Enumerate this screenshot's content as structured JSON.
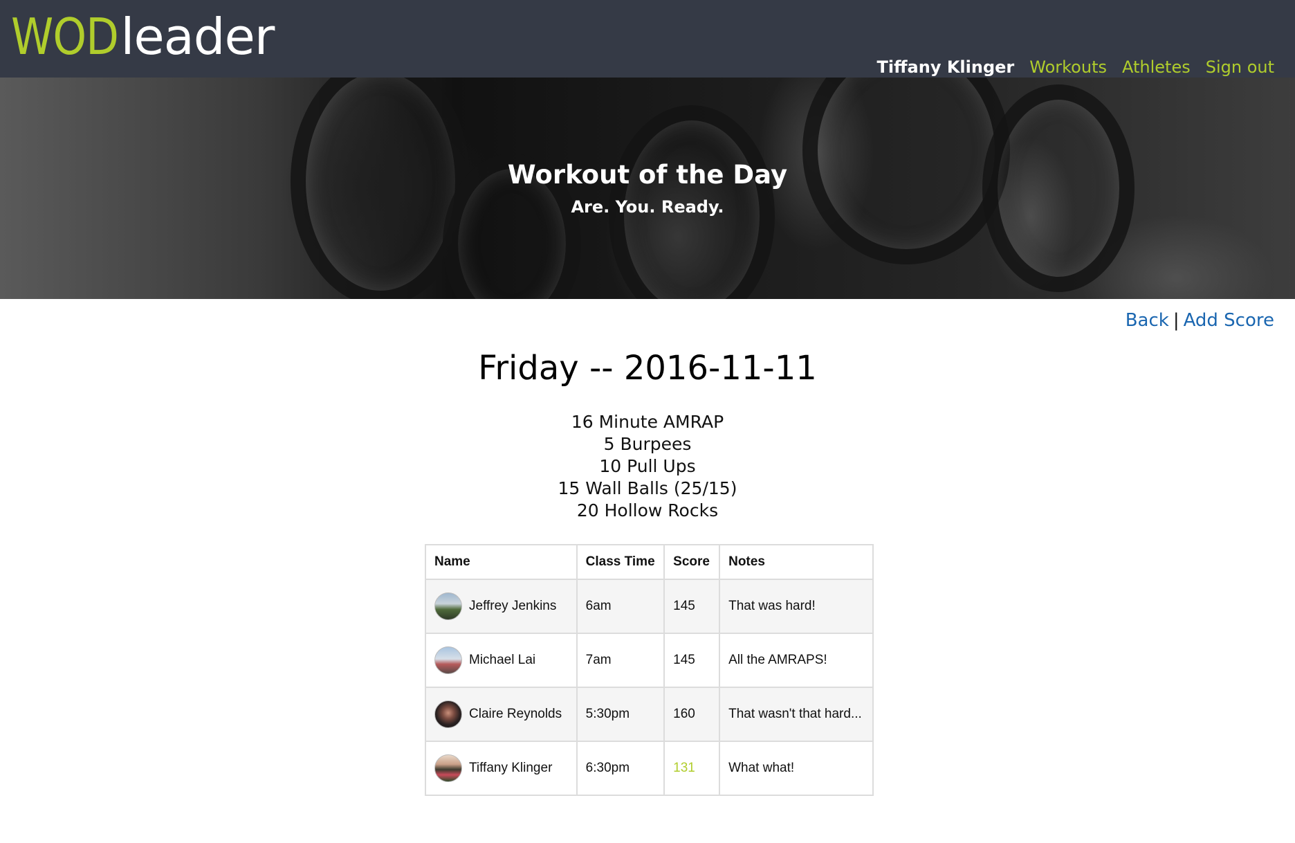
{
  "app": {
    "logo_part1": "WOD",
    "logo_part2": "leader",
    "brand_color": "#b0cd2c",
    "navbar_color": "#353a46"
  },
  "nav": {
    "user_name": "Tiffany Klinger",
    "links": [
      "Workouts",
      "Athletes",
      "Sign out"
    ]
  },
  "hero": {
    "title": "Workout of the Day",
    "subtitle": "Are. You. Ready."
  },
  "actions": {
    "back_label": "Back",
    "separator": "|",
    "add_score_label": "Add Score",
    "link_color": "#1a66b0"
  },
  "workout": {
    "heading": "Friday -- 2016-11-11",
    "lines": [
      "16 Minute AMRAP",
      "5 Burpees",
      "10 Pull Ups",
      "15 Wall Balls (25/15)",
      "20 Hollow Rocks"
    ]
  },
  "scores_table": {
    "headers": [
      "Name",
      "Class Time",
      "Score",
      "Notes"
    ],
    "rows": [
      {
        "name": "Jeffrey Jenkins",
        "class_time": "6am",
        "score": "145",
        "notes": "That was hard!",
        "avatar_icon": "athlete-avatar-icon"
      },
      {
        "name": "Michael Lai",
        "class_time": "7am",
        "score": "145",
        "notes": "All the AMRAPS!",
        "avatar_icon": "athlete-avatar-icon"
      },
      {
        "name": "Claire Reynolds",
        "class_time": "5:30pm",
        "score": "160",
        "notes": "That wasn't that hard...",
        "avatar_icon": "athlete-avatar-icon"
      },
      {
        "name": "Tiffany Klinger",
        "class_time": "6:30pm",
        "score": "131",
        "notes": "What what!",
        "avatar_icon": "athlete-avatar-icon",
        "current_user": true
      }
    ]
  }
}
